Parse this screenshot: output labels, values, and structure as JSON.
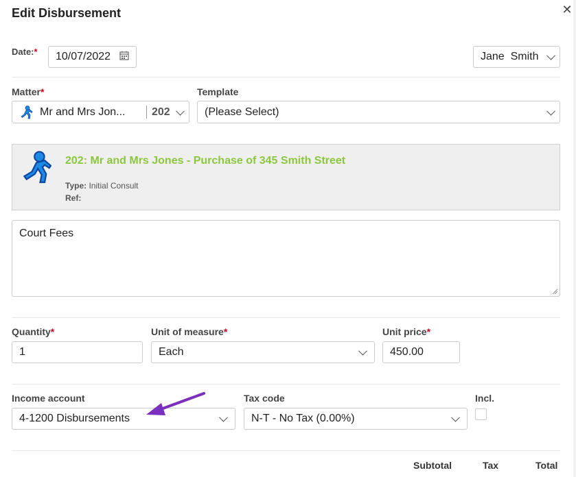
{
  "header": {
    "title": "Edit Disbursement",
    "close_icon": "close-icon"
  },
  "date": {
    "label": "Date:",
    "required_mark": "*",
    "value": "10/07/2022",
    "icon": "calendar-icon"
  },
  "user_select": {
    "value": "Jane  Smith"
  },
  "matter": {
    "label": "Matter",
    "required_mark": "*",
    "name": "Mr and Mrs Jon...",
    "number": "202",
    "icon": "running-person-icon"
  },
  "template": {
    "label": "Template",
    "value": "(Please Select)"
  },
  "matter_card": {
    "title": "202: Mr and Mrs Jones - Purchase of 345 Smith Street",
    "type_label": "Type:",
    "type_value": "Initial Consult",
    "ref_label": "Ref:",
    "ref_value": ""
  },
  "description": {
    "value": "Court Fees"
  },
  "quantity": {
    "label": "Quantity",
    "required_mark": "*",
    "value": "1"
  },
  "unit_of_measure": {
    "label": "Unit of measure",
    "required_mark": "*",
    "value": "Each"
  },
  "unit_price": {
    "label": "Unit price",
    "required_mark": "*",
    "value": "450.00"
  },
  "income_account": {
    "label": "Income account",
    "value": "4-1200 Disbursements"
  },
  "tax_code": {
    "label": "Tax code",
    "value": "N-T - No Tax (0.00%)"
  },
  "incl": {
    "label": "Incl.",
    "checked": false
  },
  "totals": {
    "subtotal_label": "Subtotal",
    "tax_label": "Tax",
    "total_label": "Total"
  },
  "annotation": {
    "arrow_color": "#7b2fbe"
  },
  "colors": {
    "matter_title": "#8cc63f",
    "required": "#d0021b",
    "icon_blue": "#1565c0"
  }
}
